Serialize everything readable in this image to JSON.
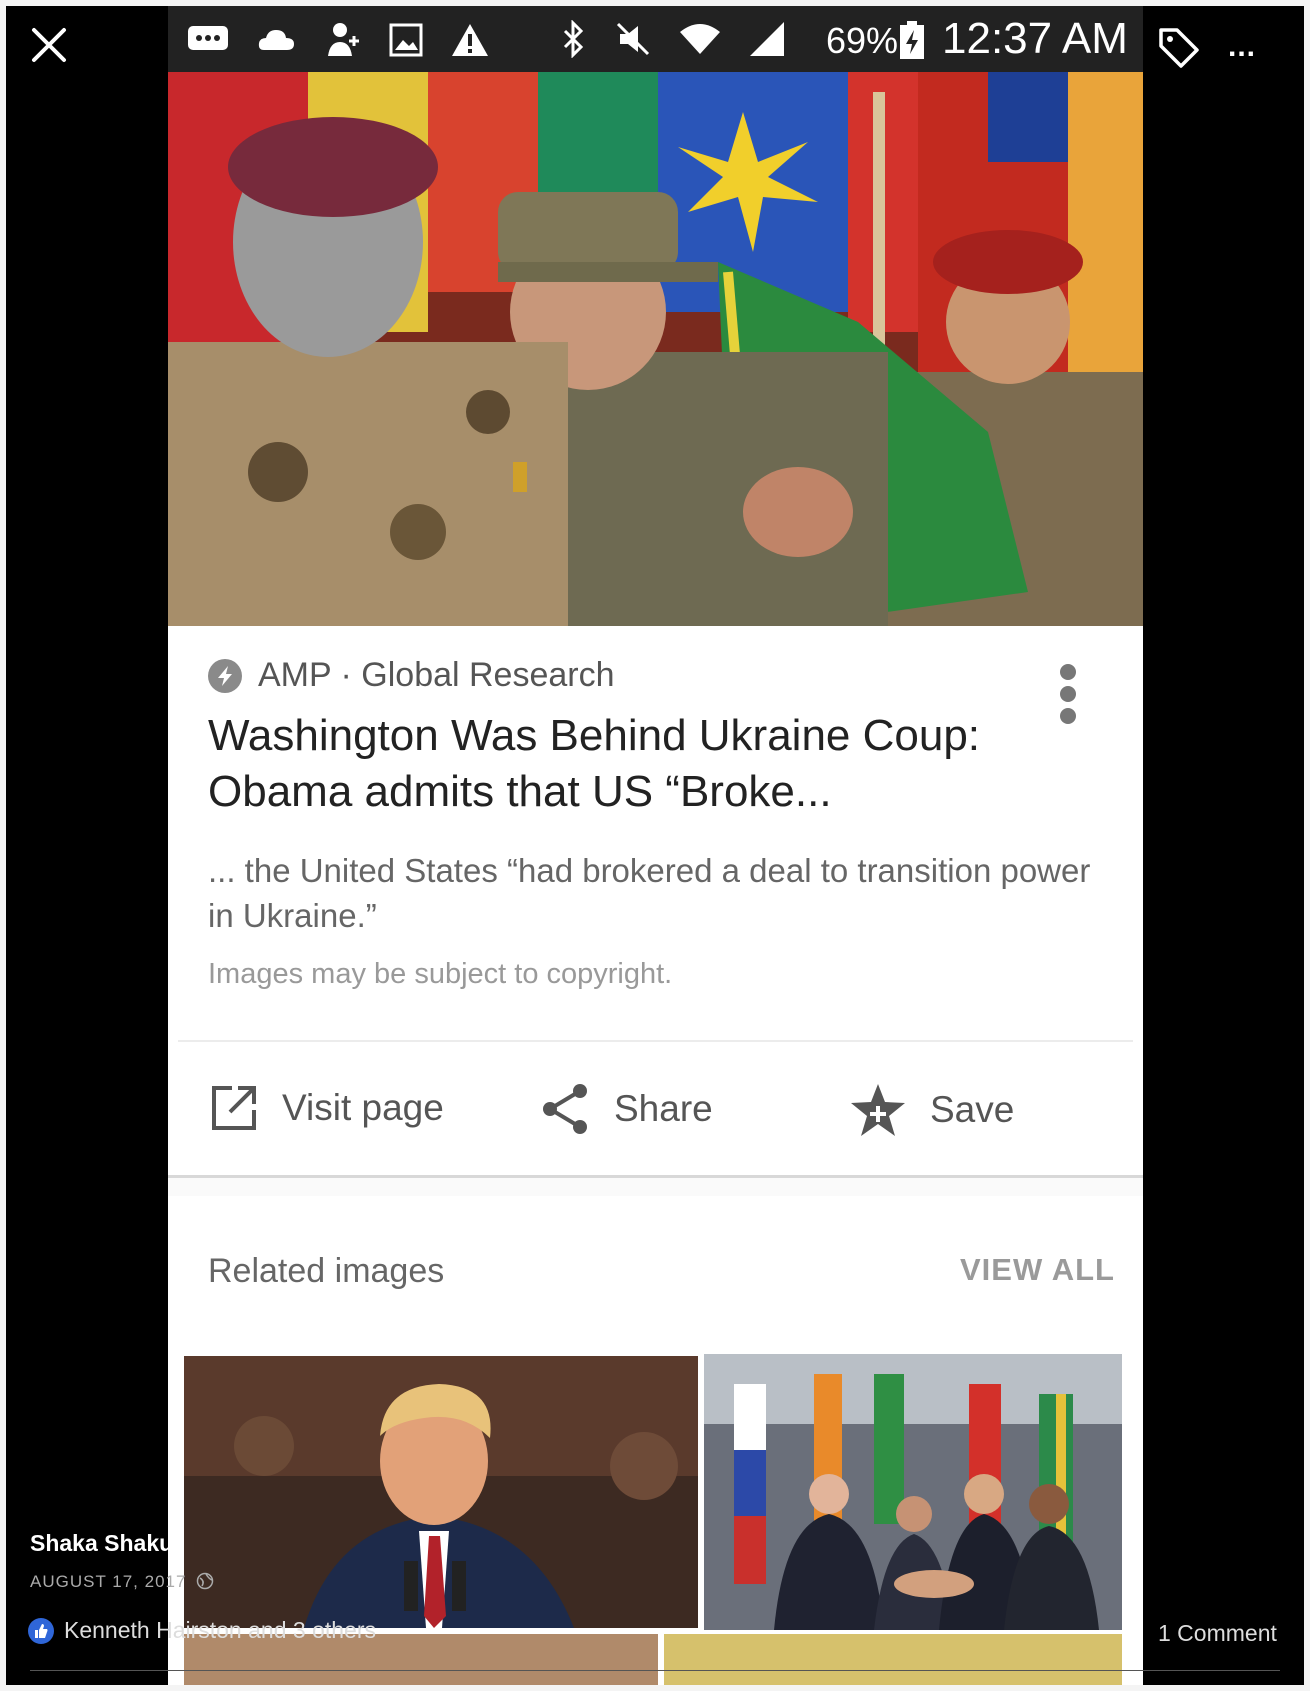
{
  "viewer": {
    "close_icon": "close-icon",
    "tag_icon": "tag-icon",
    "more_label": "..."
  },
  "statusbar": {
    "battery": "69%",
    "time": "12:37 AM"
  },
  "result_card": {
    "source": "AMP · Global Research",
    "headline": "Washington Was Behind Ukraine Coup: Obama admits that US “Broke...",
    "snippet": "... the United States “had brokered a deal to transition power in Ukraine.”",
    "copyright_note": "Images may be subject to copyright.",
    "actions": {
      "visit": "Visit page",
      "share": "Share",
      "save": "Save"
    }
  },
  "related": {
    "title": "Related images",
    "view_all": "VIEW ALL"
  },
  "facebook": {
    "author": "Shaka Shakur",
    "date": "AUGUST 17, 2017",
    "reactions": "Kenneth Hairston and 3 others",
    "comments": "1 Comment"
  },
  "colors": {
    "background": "#000000",
    "card": "#ffffff",
    "statusbar": "#222222",
    "like_blue": "#2f66d8"
  }
}
